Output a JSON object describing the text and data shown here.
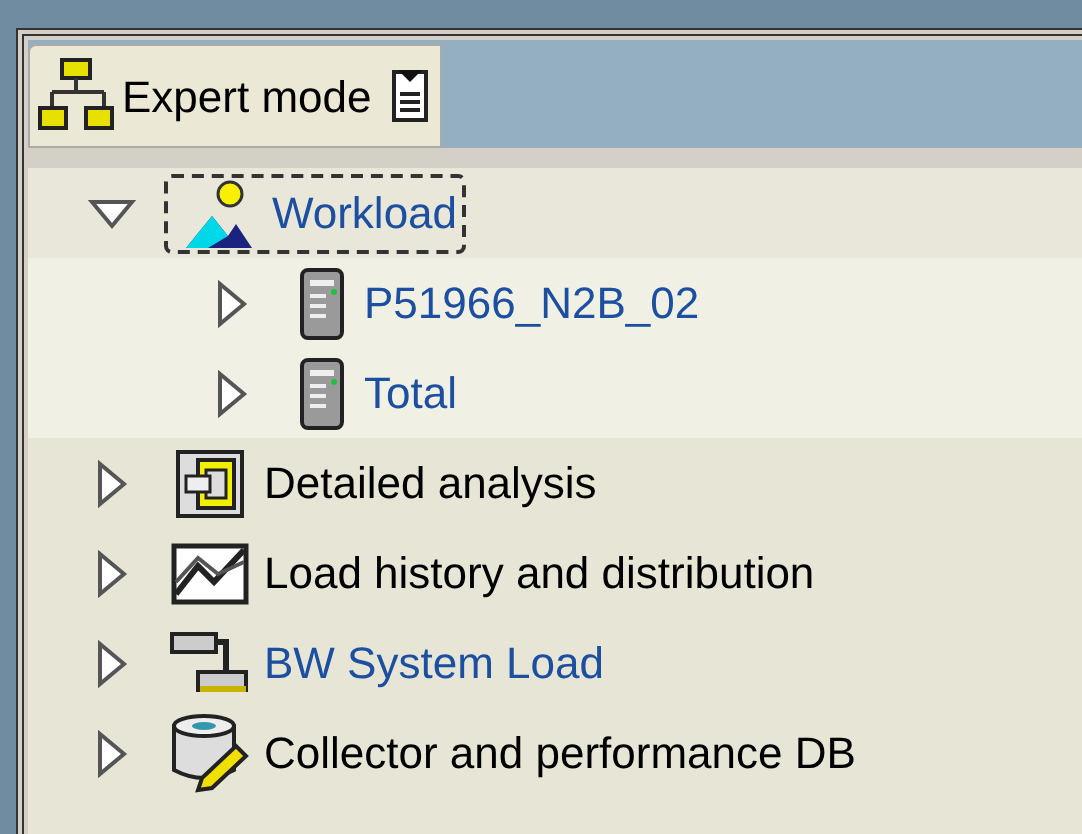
{
  "tab": {
    "label": "Expert mode"
  },
  "tree": [
    {
      "label": "Workload",
      "kind": "workload",
      "link": true,
      "focused": true,
      "expanded": true,
      "children": [
        {
          "label": "P51966_N2B_02",
          "kind": "server",
          "link": true,
          "focused": false,
          "expanded": false
        },
        {
          "label": "Total",
          "kind": "server",
          "link": true,
          "focused": false,
          "expanded": false
        }
      ]
    },
    {
      "label": "Detailed analysis",
      "kind": "analysis",
      "link": false,
      "focused": false,
      "expanded": false
    },
    {
      "label": "Load history and distribution",
      "kind": "chart",
      "link": false,
      "focused": false,
      "expanded": false
    },
    {
      "label": "BW System Load",
      "kind": "bars",
      "link": true,
      "focused": false,
      "expanded": false
    },
    {
      "label": "Collector and performance DB",
      "kind": "database",
      "link": false,
      "focused": false,
      "expanded": false
    }
  ]
}
